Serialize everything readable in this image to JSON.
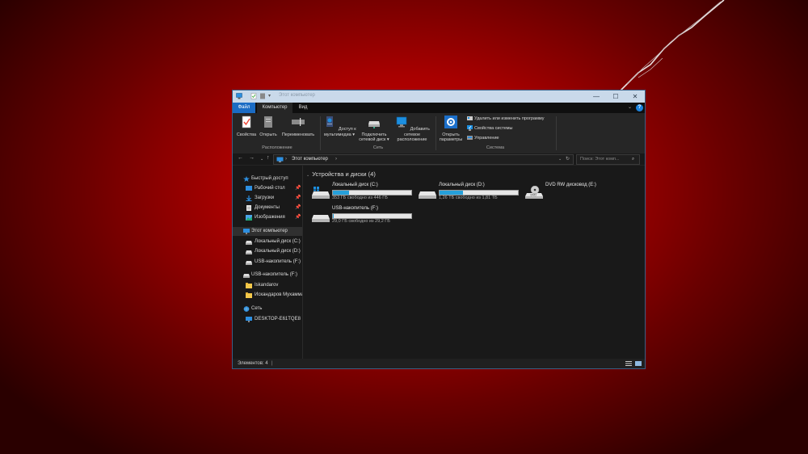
{
  "window": {
    "title": "Этот компьютер",
    "minimize_glyph": "—",
    "maximize_glyph": "☐",
    "close_glyph": "✕"
  },
  "ribbon_tabs": [
    {
      "label": "Файл"
    },
    {
      "label": "Компьютер"
    },
    {
      "label": "Вид"
    }
  ],
  "ribbon": {
    "properties": "Свойства",
    "open": "Открыть",
    "rename": "Переименовать",
    "group_location": "Расположение",
    "media_access": [
      "Доступ к",
      "мультимедиа ▾"
    ],
    "map_drive": [
      "Подключить",
      "сетевой диск ▾"
    ],
    "add_location": [
      "Добавить сетевое",
      "расположение"
    ],
    "group_network": "Сеть",
    "open_settings": [
      "Открыть",
      "параметры"
    ],
    "uninstall": "Удалить или изменить программу",
    "system_props": "Свойства системы",
    "manage": "Управление",
    "group_system": "Система"
  },
  "address": {
    "path": "Этот компьютер",
    "separator": "›",
    "search_placeholder": "Поиск: Этот комп..."
  },
  "nav": {
    "quick_access": "Быстрый доступ",
    "desktop": "Рабочий стол",
    "downloads": "Загрузки",
    "documents": "Документы",
    "pictures": "Изображения",
    "this_pc": "Этот компьютер",
    "disk_c": "Локальный диск (C:)",
    "disk_d": "Локальный диск (D:)",
    "usb_sub": "USB-накопитель (F:)",
    "usb_root": "USB-накопитель (F:)",
    "folder1": "Iskandarov",
    "folder2": "Искандаров Мухаммад",
    "network": "Сеть",
    "desktop_host": "DESKTOP-E61TQE8"
  },
  "content": {
    "group_header": "Устройства и диски (4)",
    "drives": [
      {
        "name": "Локальный диск (C:)",
        "free": "353 ГБ свободно из 446 ГБ",
        "used_fraction": 0.21
      },
      {
        "name": "Локальный диск (D:)",
        "free": "1,26 ТБ свободно из 1,81 ТБ",
        "used_fraction": 0.3
      },
      {
        "name": "DVD RW дисковод (E:)"
      },
      {
        "name": "USB-накопитель (F:)",
        "free": "29,0 ГБ свободно из 29,2 ГБ",
        "used_fraction": 0.01
      }
    ]
  },
  "status": {
    "items": "Элементов: 4"
  },
  "colors": {
    "accent": "#1b6cc4",
    "bar_fill": "#26a0da",
    "title_bar": "#c9d9ea"
  }
}
